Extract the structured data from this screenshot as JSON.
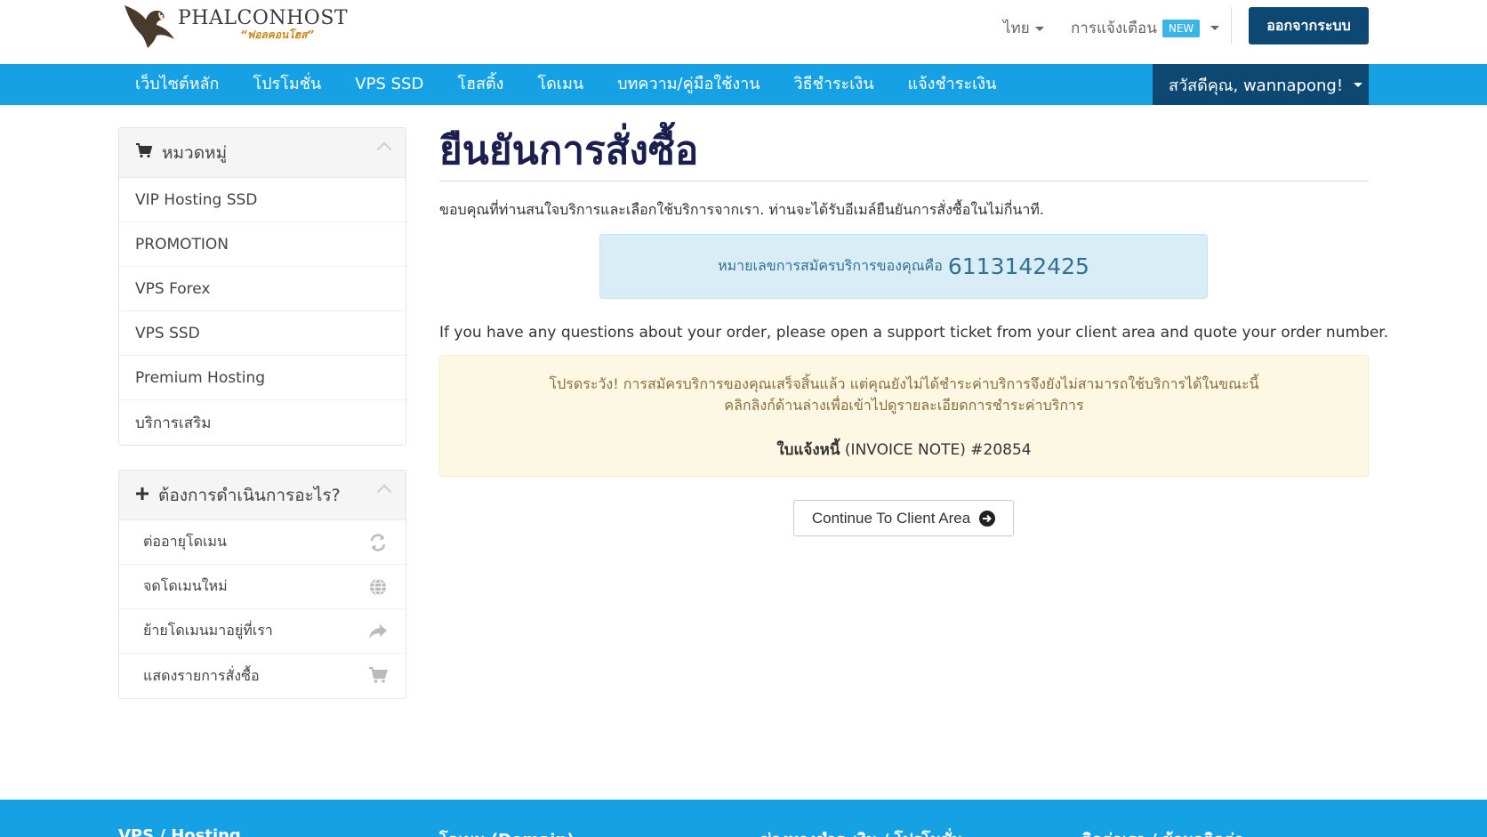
{
  "header": {
    "logo": {
      "brand": "PHALCONHOST",
      "tagline": "“ฟอลคอนโฮส”"
    },
    "language": "ไทย",
    "notifications": {
      "label": "การแจ้งเตือน",
      "badge": "NEW"
    },
    "logout_label": "ออกจากระบบ"
  },
  "nav": {
    "items": [
      {
        "label": "เว็บไซต์หลัก"
      },
      {
        "label": "โปรโมชั่น"
      },
      {
        "label": "VPS SSD"
      },
      {
        "label": "โฮสติ้ง"
      },
      {
        "label": "โดเมน"
      },
      {
        "label": "บทความ/คู่มือใช้งาน"
      },
      {
        "label": "วิธีชำระเงิน"
      },
      {
        "label": "แจ้งชำระเงิน"
      }
    ],
    "user_label": "สวัสดีคุณ, wannapong!"
  },
  "sidebar": {
    "categories": {
      "title": "หมวดหมู่",
      "items": [
        {
          "label": "VIP Hosting SSD"
        },
        {
          "label": "PROMOTION"
        },
        {
          "label": "VPS Forex"
        },
        {
          "label": "VPS SSD"
        },
        {
          "label": "Premium Hosting"
        },
        {
          "label": "บริการเสริม"
        }
      ]
    },
    "actions": {
      "title": "ต้องการดำเนินการอะไร?",
      "items": [
        {
          "label": "ต่ออายุโดเมน",
          "icon": "refresh-icon"
        },
        {
          "label": "จดโดเมนใหม่",
          "icon": "globe-icon"
        },
        {
          "label": "ย้ายโดเมนมาอยู่ที่เรา",
          "icon": "share-arrow-icon"
        },
        {
          "label": "แสดงรายการสั่งซื้อ",
          "icon": "cart-icon"
        }
      ]
    }
  },
  "main": {
    "title": "ยืนยันการสั่งซื้อ",
    "thanks": "ขอบคุณที่ท่านสนใจบริการและเลือกใช้บริการจากเรา. ท่านจะได้รับอีเมล์ยืนยันการสั่งซื้อในไม่กี่นาที.",
    "order_label": "หมายเลขการสมัครบริการของคุณคือ",
    "order_number": "6113142425",
    "question": "If you have any questions about your order, please open a support ticket from your client area and quote your order number.",
    "warning_line1": "โปรดระวัง! การสมัครบริการของคุณเสร็จสิ้นแล้ว แต่คุณยังไม่ได้ชำระค่าบริการจึงยังไม่สามารถใช้บริการได้ในขณะนี้",
    "warning_line2": "คลิกลิงก์ด้านล่างเพื่อเข้าไปดูรายละเอียดการชำระค่าบริการ",
    "invoice_bold": "ใบแจ้งหนี้",
    "invoice_rest": " (INVOICE NOTE) #20854",
    "continue_label": "Continue To Client Area"
  },
  "footer": {
    "cols": [
      {
        "label": "VPS / Hosting"
      },
      {
        "label": "โดเมน (Domain)"
      },
      {
        "label": "ช่องทางชำระเงิน / โปรโมชั่น"
      },
      {
        "label": "ติดต่อเรา / ข้อมูลติดต่อ"
      }
    ]
  },
  "colors": {
    "nav_bg": "#15a1e3",
    "dark_blue": "#0d4872",
    "title_color": "#1a1f4f",
    "info_bg": "#d9edf7",
    "warning_bg": "#fcf8e3"
  }
}
